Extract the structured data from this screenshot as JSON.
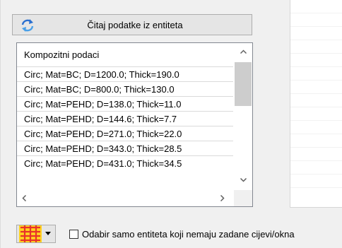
{
  "read_button": {
    "label": "Čitaj podatke iz entiteta",
    "icon": "refresh-arrows-icon"
  },
  "list": {
    "header": "Kompozitni podaci",
    "rows": [
      "Circ; Mat=BC; D=1200.0; Thick=190.0",
      "Circ; Mat=BC; D=800.0; Thick=130.0",
      "Circ; Mat=PEHD; D=138.0; Thick=11.0",
      "Circ; Mat=PEHD; D=144.6; Thick=7.7",
      "Circ; Mat=PEHD; D=271.0; Thick=22.0",
      "Circ; Mat=PEHD; D=343.0; Thick=28.5",
      "Circ; Mat=PEHD; D=431.0; Thick=34.5"
    ]
  },
  "checkbox": {
    "label": "Odabir samo entiteta koji nemaju zadane cijevi/okna",
    "checked": false
  },
  "icon_dropdown": {
    "icon": "grid-pattern-icon"
  },
  "colors": {
    "grid_icon_red": "#e8322a",
    "grid_icon_yellow": "#ffd21f",
    "refresh_icon_blue": "#2a6fcf"
  }
}
